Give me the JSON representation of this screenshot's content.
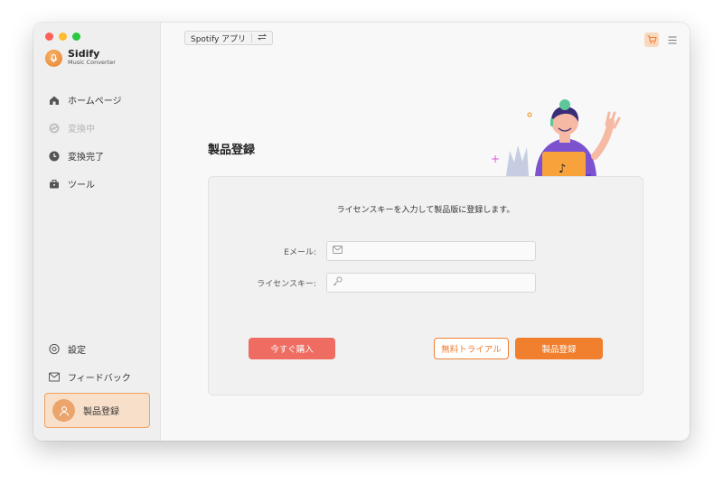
{
  "window": {
    "traffic_lights": [
      "close",
      "minimize",
      "zoom"
    ]
  },
  "brand": {
    "name": "Sidify",
    "subtitle": "Music Converter",
    "icon": "brand-logo-icon"
  },
  "sidebar": {
    "items": [
      {
        "label": "ホームページ",
        "icon": "home-icon",
        "disabled": false
      },
      {
        "label": "変換中",
        "icon": "converting-icon",
        "disabled": true
      },
      {
        "label": "変換完了",
        "icon": "clock-icon",
        "disabled": false
      },
      {
        "label": "ツール",
        "icon": "toolbox-icon",
        "disabled": false
      }
    ],
    "bottom_items": [
      {
        "label": "設定",
        "icon": "gear-icon"
      },
      {
        "label": "フィードバック",
        "icon": "mail-icon"
      }
    ],
    "account": {
      "label": "製品登録",
      "icon": "user-icon"
    }
  },
  "topbar": {
    "source_label": "Spotify アプリ",
    "switch_icon": "swap-icon",
    "cart_icon": "cart-icon",
    "menu_icon": "menu-icon"
  },
  "main": {
    "title": "製品登録",
    "card": {
      "intro": "ライセンスキーを入力して製品版に登録します。",
      "email": {
        "label": "Eメール:",
        "value": "",
        "placeholder": ""
      },
      "license": {
        "label": "ライセンスキー:",
        "value": "",
        "placeholder": ""
      },
      "buy_label": "今すぐ購入",
      "trial_label": "無料トライアル",
      "register_label": "製品登録"
    }
  },
  "colors": {
    "accent": "#f07f2e",
    "buy": "#ee6c61",
    "sidebar_bg": "#efefef",
    "account_bg": "#f7dfca"
  }
}
